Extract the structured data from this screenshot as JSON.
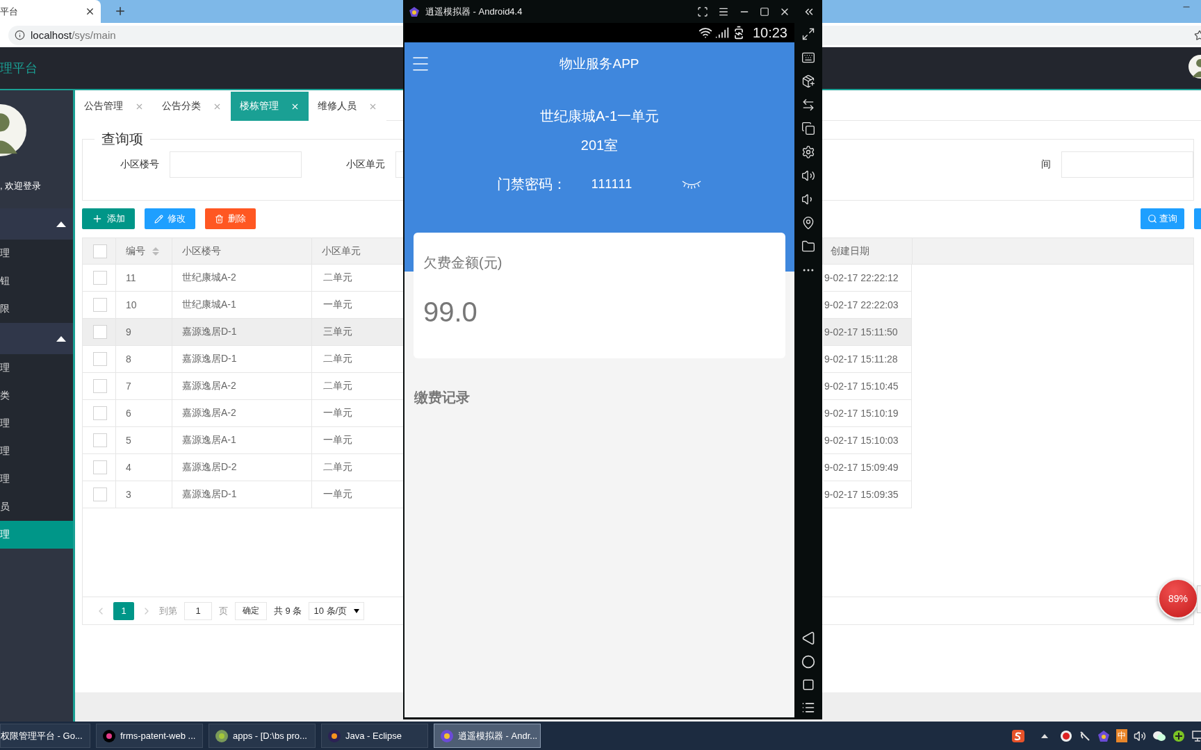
{
  "browser": {
    "tab_title": "平台",
    "address_host": "localhost",
    "address_path": "/sys/main"
  },
  "header": {
    "title": "理平台"
  },
  "sidebar": {
    "welcome": ", 欢迎登录",
    "groups": [
      {
        "expanded": true,
        "items": [
          {
            "label": "理",
            "selected": false
          },
          {
            "label": "钮",
            "selected": false
          },
          {
            "label": "限",
            "selected": false
          }
        ]
      },
      {
        "expanded": true,
        "items": [
          {
            "label": "理",
            "selected": false
          },
          {
            "label": "类",
            "selected": false
          },
          {
            "label": "理",
            "selected": false
          },
          {
            "label": "理",
            "selected": false
          },
          {
            "label": "理",
            "selected": false
          },
          {
            "label": "员",
            "selected": false
          },
          {
            "label": "理",
            "selected": true
          }
        ]
      }
    ]
  },
  "tabs": [
    {
      "label": "公告管理",
      "selected": false
    },
    {
      "label": "公告分类",
      "selected": false
    },
    {
      "label": "楼栋管理",
      "selected": true
    },
    {
      "label": "维修人员",
      "selected": false
    }
  ],
  "query": {
    "legend": "查询项",
    "fields": [
      {
        "label": "小区楼号"
      },
      {
        "label": "小区单元"
      },
      {
        "label": "间"
      }
    ]
  },
  "actions": [
    {
      "kind": "add",
      "label": "添加"
    },
    {
      "kind": "edit",
      "label": "修改"
    },
    {
      "kind": "delete",
      "label": "删除"
    }
  ],
  "search_button": "查询",
  "table": {
    "all_checked": false,
    "columns": [
      "编号",
      "小区楼号",
      "小区单元",
      "创建日期"
    ],
    "rows": [
      {
        "checked": false,
        "highlighted": false,
        "id": "11",
        "building": "世纪康城A-2",
        "unit": "二单元",
        "created": "9-02-17 22:22:12"
      },
      {
        "checked": false,
        "highlighted": false,
        "id": "10",
        "building": "世纪康城A-1",
        "unit": "一单元",
        "created": "9-02-17 22:22:03"
      },
      {
        "checked": false,
        "highlighted": true,
        "id": "9",
        "building": "嘉源逸居D-1",
        "unit": "三单元",
        "created": "9-02-17 15:11:50"
      },
      {
        "checked": false,
        "highlighted": false,
        "id": "8",
        "building": "嘉源逸居D-1",
        "unit": "二单元",
        "created": "9-02-17 15:11:28"
      },
      {
        "checked": false,
        "highlighted": false,
        "id": "7",
        "building": "嘉源逸居A-2",
        "unit": "二单元",
        "created": "9-02-17 15:10:45"
      },
      {
        "checked": false,
        "highlighted": false,
        "id": "6",
        "building": "嘉源逸居A-2",
        "unit": "一单元",
        "created": "9-02-17 15:10:19"
      },
      {
        "checked": false,
        "highlighted": false,
        "id": "5",
        "building": "嘉源逸居A-1",
        "unit": "一单元",
        "created": "9-02-17 15:10:03"
      },
      {
        "checked": false,
        "highlighted": false,
        "id": "4",
        "building": "嘉源逸居D-2",
        "unit": "二单元",
        "created": "9-02-17 15:09:49"
      },
      {
        "checked": false,
        "highlighted": false,
        "id": "3",
        "building": "嘉源逸居D-1",
        "unit": "一单元",
        "created": "9-02-17 15:09:35"
      }
    ]
  },
  "pagination": {
    "pages": [
      {
        "label": "1",
        "selected": true
      }
    ],
    "goto_label": "到第",
    "goto_value": "1",
    "page_unit": "页",
    "confirm": "确定",
    "total": "共 9 条",
    "page_size": "10 条/页"
  },
  "speed_ball": "89%",
  "emulator": {
    "title": "逍遥模拟器 - Android4.4",
    "time": "10:23",
    "app_title": "物业服务APP",
    "address": "世纪康城A-1一单元",
    "room": "201室",
    "door_label": "门禁密码：",
    "door_code": "111111",
    "arrears_label": "欠费金额(元)",
    "arrears": "99.0",
    "records_title": "缴费记录"
  },
  "taskbar": {
    "items": [
      {
        "label": "权限管理平台 - Go...",
        "selected": false
      },
      {
        "kind": "idea",
        "label": "frms-patent-web ...",
        "selected": false
      },
      {
        "kind": "android",
        "label": "apps - [D:\\bs pro...",
        "selected": false
      },
      {
        "kind": "eclipse",
        "label": "Java - Eclipse",
        "selected": false
      },
      {
        "kind": "emulator",
        "label": "逍遥模拟器 - Andr...",
        "selected": true
      }
    ],
    "ime": "中"
  }
}
